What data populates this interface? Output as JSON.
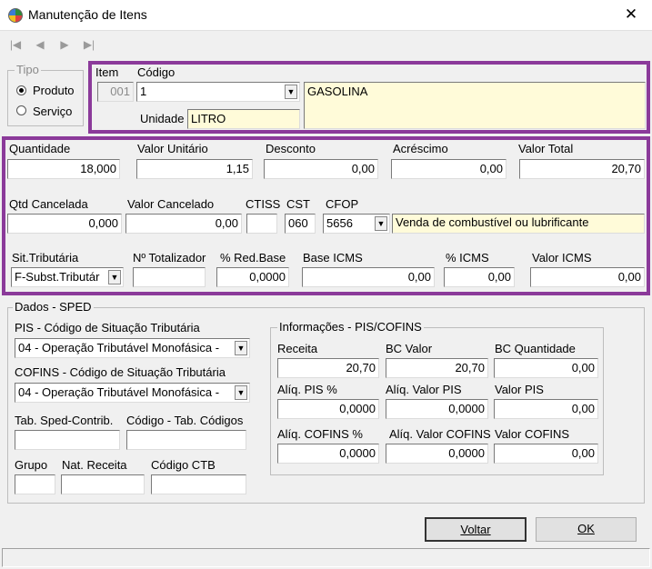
{
  "window": {
    "title": "Manutenção de Itens",
    "close_symbol": "✕"
  },
  "nav": {
    "first": "|◀",
    "prev": "◀",
    "next": "▶",
    "last": "▶|"
  },
  "tipo": {
    "legend": "Tipo",
    "produto": "Produto",
    "servico": "Serviço",
    "selected": "Produto"
  },
  "item": {
    "item_label": "Item",
    "item_value": "001",
    "codigo_label": "Código",
    "codigo_value": "1",
    "descricao_value": "GASOLINA",
    "unidade_label": "Unidade",
    "unidade_value": "LITRO"
  },
  "valores": {
    "quantidade_label": "Quantidade",
    "quantidade_value": "18,000",
    "valor_unitario_label": "Valor Unitário",
    "valor_unitario_value": "1,15",
    "desconto_label": "Desconto",
    "desconto_value": "0,00",
    "acrescimo_label": "Acréscimo",
    "acrescimo_value": "0,00",
    "valor_total_label": "Valor Total",
    "valor_total_value": "20,70",
    "qtd_cancelada_label": "Qtd Cancelada",
    "qtd_cancelada_value": "0,000",
    "valor_cancelado_label": "Valor Cancelado",
    "valor_cancelado_value": "0,00",
    "ctiss_label": "CTISS",
    "ctiss_value": "",
    "cst_label": "CST",
    "cst_value": "060",
    "cfop_label": "CFOP",
    "cfop_value": "5656",
    "cfop_desc": "Venda de combustível ou lubrificante",
    "sit_trib_label": "Sit.Tributária",
    "sit_trib_value": "F-Subst.Tributár",
    "totalizador_label": "Nº Totalizador",
    "totalizador_value": "",
    "red_base_label": "% Red.Base",
    "red_base_value": "0,0000",
    "base_icms_label": "Base ICMS",
    "base_icms_value": "0,00",
    "icms_label": "% ICMS",
    "icms_value": "0,00",
    "valor_icms_label": "Valor ICMS",
    "valor_icms_value": "0,00"
  },
  "sped": {
    "legend": "Dados - SPED",
    "pis_label": "PIS -  Código de Situação Tributária",
    "pis_value": "04 - Operação Tributável Monofásica -",
    "cofins_label": "COFINS -  Código de Situação Tributária",
    "cofins_value": "04 - Operação Tributável Monofásica -",
    "tab_sped_label": "Tab. Sped-Contrib.",
    "tab_sped_value": "",
    "cod_tab_label": "Código - Tab. Códigos",
    "cod_tab_value": "",
    "grupo_label": "Grupo",
    "grupo_value": "",
    "nat_receita_label": "Nat. Receita",
    "nat_receita_value": "",
    "cod_ctb_label": "Código CTB",
    "cod_ctb_value": ""
  },
  "pis_cofins": {
    "legend": "Informações - PIS/COFINS",
    "receita_label": "Receita",
    "receita_value": "20,70",
    "bc_valor_label": "BC Valor",
    "bc_valor_value": "20,70",
    "bc_qtd_label": "BC Quantidade",
    "bc_qtd_value": "0,00",
    "aliq_pis_label": "Alíq. PIS %",
    "aliq_pis_value": "0,0000",
    "aliq_valor_pis_label": "Alíq. Valor PIS",
    "aliq_valor_pis_value": "0,0000",
    "valor_pis_label": "Valor PIS",
    "valor_pis_value": "0,00",
    "aliq_cofins_label": "Alíq. COFINS %",
    "aliq_cofins_value": "0,0000",
    "aliq_valor_cofins_label": "Alíq. Valor COFINS",
    "aliq_valor_cofins_value": "0,0000",
    "valor_cofins_label": "Valor COFINS",
    "valor_cofins_value": "0,00"
  },
  "buttons": {
    "voltar": "Voltar",
    "ok": "OK"
  },
  "colors": {
    "highlight_border": "#8b3a9a",
    "field_yellow": "#fffbd9"
  },
  "icons": {
    "dropdown": "dropdown-arrow-icon"
  }
}
